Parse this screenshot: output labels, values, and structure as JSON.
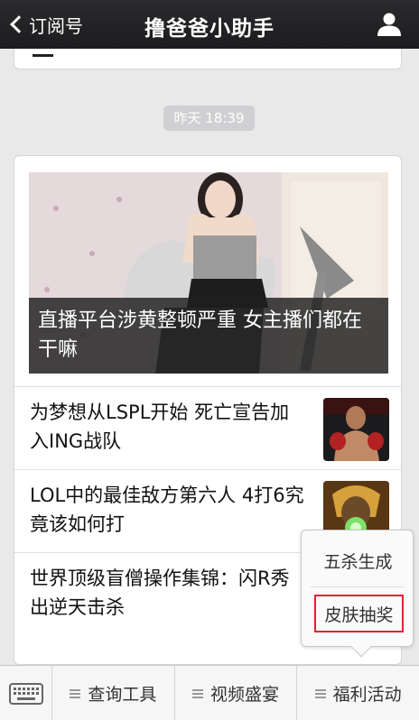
{
  "header": {
    "back_label": "订阅号",
    "title": "撸爸爸小助手"
  },
  "timestamp": "昨天 18:39",
  "article": {
    "hero_title": "直播平台涉黄整顿严重 女主播们都在干嘛",
    "items": [
      {
        "title": "为梦想从LSPL开始 死亡宣告加入ING战队"
      },
      {
        "title": "LOL中的最佳敌方第六人 4打6究竟该如何打"
      },
      {
        "title": "世界顶级盲僧操作集锦：闪R秀出逆天击杀"
      }
    ]
  },
  "popup_menu": {
    "items": [
      "五杀生成",
      "皮肤抽奖"
    ],
    "highlight_color": "#e0232e"
  },
  "bottom_menu": {
    "items": [
      "查询工具",
      "视频盛宴",
      "福利活动"
    ]
  }
}
